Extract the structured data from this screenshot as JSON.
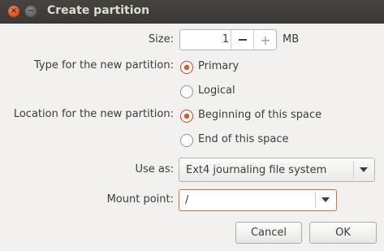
{
  "window": {
    "title": "Create partition",
    "close_glyph": "×",
    "minimize_glyph": "−"
  },
  "size": {
    "label": "Size:",
    "value": "1",
    "unit": "MB",
    "minus_icon": "minus-icon",
    "plus_glyph": "+"
  },
  "type": {
    "label": "Type for the new partition:",
    "options": [
      "Primary",
      "Logical"
    ],
    "selected": "Primary"
  },
  "location": {
    "label": "Location for the new partition:",
    "options": [
      "Beginning of this space",
      "End of this space"
    ],
    "selected": "Beginning of this space"
  },
  "use_as": {
    "label": "Use as:",
    "value": "Ext4 journaling file system"
  },
  "mount_point": {
    "label": "Mount point:",
    "value": "/"
  },
  "buttons": {
    "cancel": "Cancel",
    "ok": "OK"
  },
  "colors": {
    "accent": "#e1592a",
    "title_bar": "#3c3b37",
    "background": "#f2f1f0"
  }
}
